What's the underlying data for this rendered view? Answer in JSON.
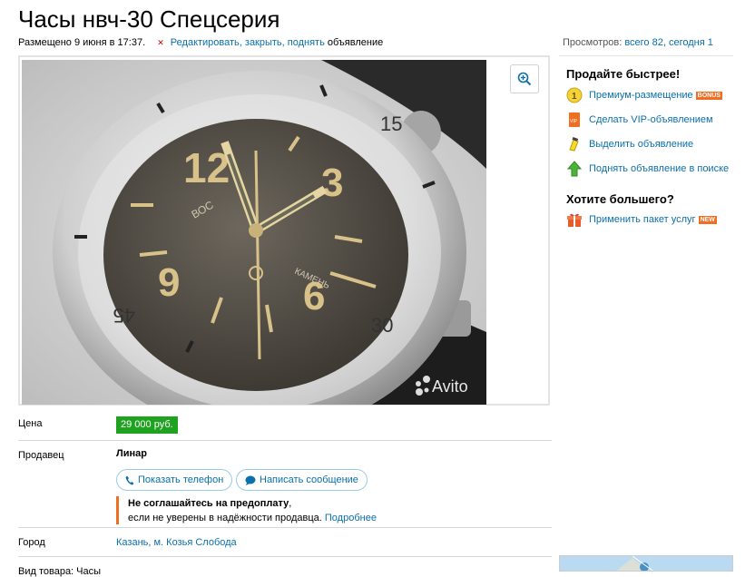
{
  "listing": {
    "title": "Часы нвч-30 Спецсерия",
    "posted": "Размещено 9 июня в 17:37.",
    "edit_link": "Редактировать, закрыть, поднять",
    "edit_suffix": " объявление",
    "views_label": "Просмотров:",
    "views_value": "всего 82, сегодня 1",
    "photo_watermark": "Avito"
  },
  "sidebar": {
    "sell_faster": "Продайте быстрее!",
    "services": [
      {
        "label": "Премиум-размещение",
        "badge": "BONUS",
        "icon": "premium-coin-icon"
      },
      {
        "label": "Сделать VIP-объявлением",
        "icon": "vip-icon"
      },
      {
        "label": "Выделить объявление",
        "icon": "highlighter-icon"
      },
      {
        "label": "Поднять объявление в поиске",
        "icon": "raise-arrow-icon"
      }
    ],
    "want_more": "Хотите большего?",
    "package": {
      "label": "Применить пакет услуг",
      "badge": "NEW",
      "icon": "package-icon"
    }
  },
  "details": {
    "price_label": "Цена",
    "price_value": "29 000 руб.",
    "seller_label": "Продавец",
    "seller_name": "Линар",
    "show_phone": "Показать телефон",
    "write_message": "Написать сообщение",
    "warning_bold": "Не соглашайтесь на предоплату",
    "warning_rest": ",",
    "warning_line2": "если не уверены в надёжности продавца.",
    "warning_more": "Подробнее",
    "city_label": "Город",
    "city_value": "Казань, м. Козья Слобода",
    "cut_label": "Вид товара: Часы"
  },
  "colors": {
    "link": "#0a6fab",
    "price_bg": "#1fa21f",
    "accent_orange": "#f06d21"
  }
}
